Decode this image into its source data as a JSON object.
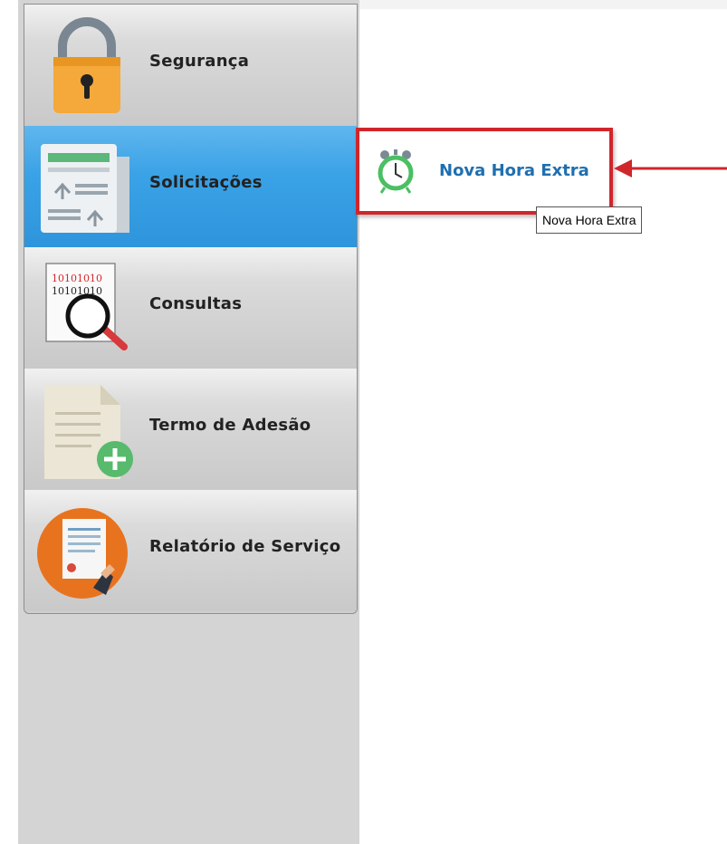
{
  "menu": {
    "items": [
      {
        "label": "Segurança",
        "icon": "padlock-icon"
      },
      {
        "label": "Solicitações",
        "icon": "request-document-icon"
      },
      {
        "label": "Consultas",
        "icon": "binary-search-icon"
      },
      {
        "label": "Termo de Adesão",
        "icon": "add-document-icon"
      },
      {
        "label": "Relatório de Serviço",
        "icon": "service-report-icon"
      }
    ],
    "active_index": 1
  },
  "submenu": {
    "link_label": "Nova Hora Extra",
    "icon": "alarm-clock-icon"
  },
  "tooltip": {
    "text": "Nova Hora Extra"
  },
  "colors": {
    "active_item": "#3aa2e6",
    "highlight_border": "#d0262b",
    "link": "#1f6fb0"
  }
}
